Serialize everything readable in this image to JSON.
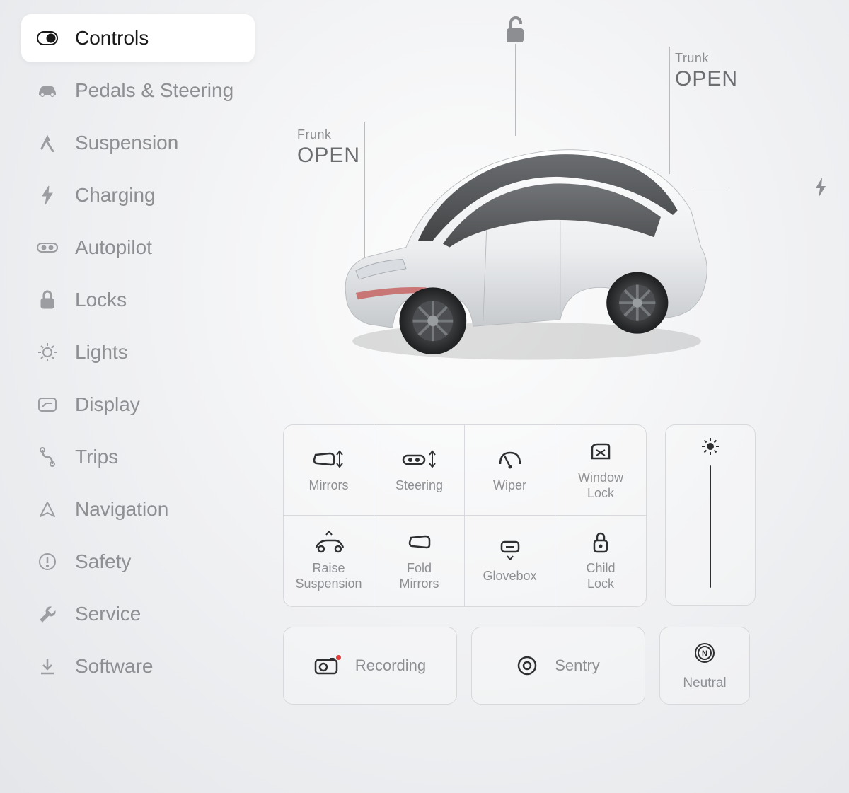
{
  "sidebar": {
    "items": [
      {
        "label": "Controls",
        "icon": "controls"
      },
      {
        "label": "Pedals & Steering",
        "icon": "pedals"
      },
      {
        "label": "Suspension",
        "icon": "suspension"
      },
      {
        "label": "Charging",
        "icon": "charging"
      },
      {
        "label": "Autopilot",
        "icon": "autopilot"
      },
      {
        "label": "Locks",
        "icon": "locks"
      },
      {
        "label": "Lights",
        "icon": "lights"
      },
      {
        "label": "Display",
        "icon": "display"
      },
      {
        "label": "Trips",
        "icon": "trips"
      },
      {
        "label": "Navigation",
        "icon": "navigation"
      },
      {
        "label": "Safety",
        "icon": "safety"
      },
      {
        "label": "Service",
        "icon": "service"
      },
      {
        "label": "Software",
        "icon": "software"
      }
    ],
    "active_index": 0
  },
  "car": {
    "frunk": {
      "label_small": "Frunk",
      "label_big": "OPEN"
    },
    "trunk": {
      "label_small": "Trunk",
      "label_big": "OPEN"
    },
    "locked": false
  },
  "quick": [
    {
      "label": "Mirrors",
      "icon": "mirrors"
    },
    {
      "label": "Steering",
      "icon": "steering"
    },
    {
      "label": "Wiper",
      "icon": "wiper"
    },
    {
      "label": "Window\nLock",
      "icon": "window-lock"
    },
    {
      "label": "Raise\nSuspension",
      "icon": "raise-suspension"
    },
    {
      "label": "Fold\nMirrors",
      "icon": "fold-mirrors"
    },
    {
      "label": "Glovebox",
      "icon": "glovebox"
    },
    {
      "label": "Child\nLock",
      "icon": "child-lock"
    }
  ],
  "bottom": {
    "recording": "Recording",
    "sentry": "Sentry",
    "neutral": "Neutral"
  }
}
